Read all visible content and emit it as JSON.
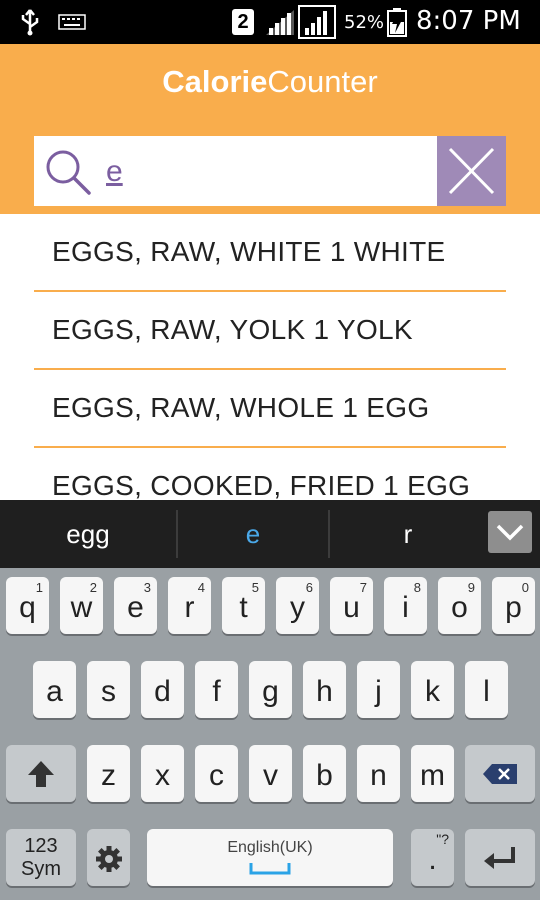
{
  "status_bar": {
    "sim_slot": "2",
    "battery_percent": "52%",
    "time": "8:07 PM"
  },
  "app": {
    "title_bold": "Calorie",
    "title_regular": "Counter"
  },
  "search": {
    "query": "e",
    "placeholder": ""
  },
  "results": [
    {
      "label": "EGGS, RAW, WHITE 1 WHITE"
    },
    {
      "label": "EGGS, RAW, YOLK 1 YOLK"
    },
    {
      "label": "EGGS, RAW, WHOLE 1 EGG"
    },
    {
      "label": "EGGS, COOKED, FRIED 1 EGG"
    }
  ],
  "suggestions": [
    "egg",
    "e",
    "r"
  ],
  "keyboard": {
    "row1": [
      {
        "key": "q",
        "num": "1"
      },
      {
        "key": "w",
        "num": "2"
      },
      {
        "key": "e",
        "num": "3"
      },
      {
        "key": "r",
        "num": "4"
      },
      {
        "key": "t",
        "num": "5"
      },
      {
        "key": "y",
        "num": "6"
      },
      {
        "key": "u",
        "num": "7"
      },
      {
        "key": "i",
        "num": "8"
      },
      {
        "key": "o",
        "num": "9"
      },
      {
        "key": "p",
        "num": "0"
      }
    ],
    "row2": [
      "a",
      "s",
      "d",
      "f",
      "g",
      "h",
      "j",
      "k",
      "l"
    ],
    "row3": [
      "z",
      "x",
      "c",
      "v",
      "b",
      "n",
      "m"
    ],
    "sym_line1": "123",
    "sym_line2": "Sym",
    "space_language": "English(UK)",
    "period": ".",
    "period_hint": "\"?"
  },
  "colors": {
    "accent_orange": "#f9ad4c",
    "clear_button_purple": "#9f8ab7",
    "suggestion_highlight": "#4aa8e8"
  }
}
